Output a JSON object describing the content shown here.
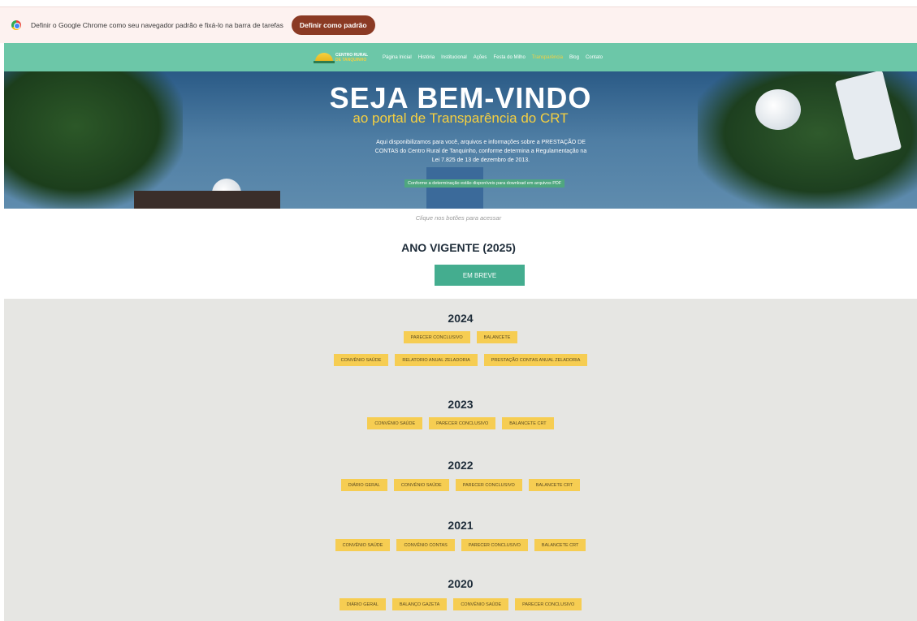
{
  "chrome_banner": {
    "message": "Definir o Google Chrome como seu navegador padrão e fixá-lo na barra de tarefas",
    "button": "Definir como padrão"
  },
  "nav": {
    "logo_line1": "CENTRO RURAL",
    "logo_line2": "DE TANQUINHO",
    "items": [
      "Página Inicial",
      "História",
      "Institucional",
      "Ações",
      "Festa do Milho",
      "Transparência",
      "Blog",
      "Contato"
    ],
    "active_item": "Transparência"
  },
  "hero": {
    "title": "SEJA BEM-VINDO",
    "subtitle": "ao portal de Transparência do CRT",
    "text": "Aqui disponibilizamos para você, arquivos e informações sobre a PRESTAÇÃO DE CONTAS do Centro Rural de Tanquinho, conforme determina a Regulamentação na Lei 7.825 de 13 de dezembro de 2013.",
    "badge": "Conforme a determinação estão disponíveis para download em arquivos PDF"
  },
  "hint": "Clique nos botões para acessar",
  "current_year": {
    "title": "ANO VIGENTE (2025)",
    "button": "EM BREVE"
  },
  "years": [
    {
      "year": "2024",
      "rows": [
        [
          "PARECER CONCLUSIVO",
          "BALANCETE"
        ],
        [
          "CONVÊNIO SAÚDE",
          "RELATORIO ANUAL ZELADORIA",
          "PRESTAÇÃO CONTAS ANUAL ZELADORIA"
        ]
      ]
    },
    {
      "year": "2023",
      "rows": [
        [
          "CONVÊNIO SAÚDE",
          "PARECER CONCLUSIVO",
          "BALANCETE CRT"
        ]
      ]
    },
    {
      "year": "2022",
      "rows": [
        [
          "DIÁRIO GERAL",
          "CONVÊNIO SAÚDE",
          "PARECER CONCLUSIVO",
          "BALANCETE CRT"
        ]
      ]
    },
    {
      "year": "2021",
      "rows": [
        [
          "CONVÊNIO SAÚDE",
          "CONVÊNIO CONTAS",
          "PARECER CONCLUSIVO",
          "BALANCETE CRT"
        ]
      ]
    },
    {
      "year": "2020",
      "rows": [
        [
          "DIÁRIO GERAL",
          "BALANÇO GAZETA",
          "CONVÊNIO SAÚDE",
          "PARECER CONCLUSIVO"
        ]
      ]
    }
  ],
  "colors": {
    "nav_bg": "#6cc7a8",
    "accent_yellow": "#f6cd52",
    "chrome_button": "#8b3a24",
    "teal_button": "#44ad8f"
  }
}
